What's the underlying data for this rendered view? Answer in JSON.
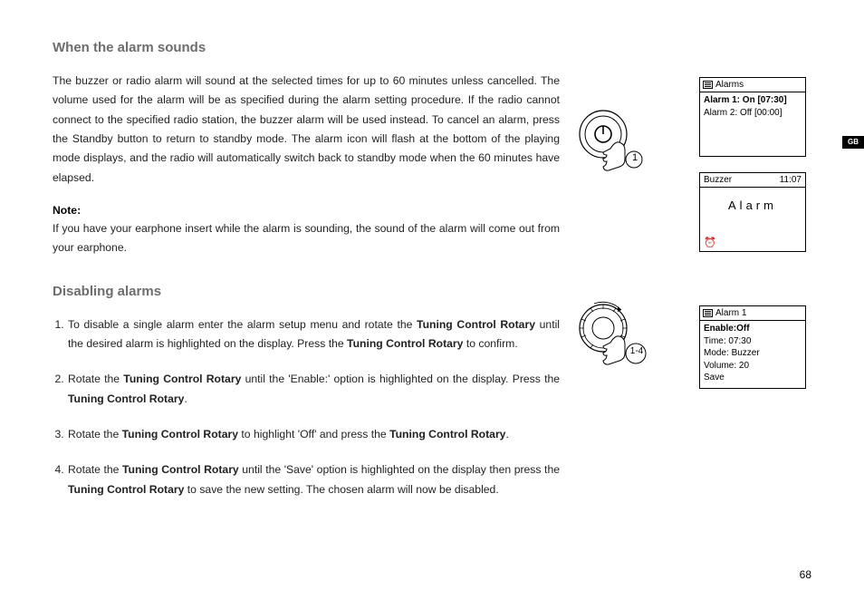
{
  "page_number": "68",
  "lang_tab": "GB",
  "sections": {
    "alarm_sounds": {
      "heading": "When the alarm sounds",
      "para": "The buzzer or radio alarm will sound at the selected times for up to 60 minutes unless cancelled. The volume used for the alarm will be as specified during the alarm setting procedure. If the radio cannot connect to the specified radio station, the buzzer alarm will be used instead. To cancel an alarm, press the Standby button to return to standby mode. The alarm icon will flash at the bottom of the playing mode displays, and the radio will automatically switch back to standby mode when the 60 minutes have elapsed.",
      "note_label": "Note:",
      "note_text": "If you have your earphone insert while the alarm is sounding, the sound of the alarm will come out from your earphone."
    },
    "disabling": {
      "heading": "Disabling alarms",
      "steps": {
        "s1a": "To disable a single alarm enter the alarm setup menu and rotate the ",
        "s1_tc1": "Tuning Control Rotary",
        "s1b": " until the desired alarm is highlighted on the display. Press the ",
        "s1_tc2": "Tuning Control Rotary",
        "s1c": " to confirm.",
        "s2a": "Rotate the ",
        "s2_tc1": "Tuning Control Rotary",
        "s2b": " until the 'Enable:' option is highlighted on the display. Press the ",
        "s2_tc2": "Tuning Control Rotary",
        "s2c": ".",
        "s3a": "Rotate the ",
        "s3_tc1": "Tuning Control Rotary",
        "s3b": " to highlight 'Off' and press the ",
        "s3_tc2": "Tuning Control Rotary",
        "s3c": ".",
        "s4a": "Rotate the ",
        "s4_tc1": "Tuning Control Rotary",
        "s4b": " until the 'Save' option is highlighted on the display then press the ",
        "s4_tc2": "Tuning Control Rotary",
        "s4c": " to save the new setting. The chosen alarm will now be disabled."
      }
    }
  },
  "illustrations": {
    "power_label": "1",
    "rotary_label": "1-4"
  },
  "panels": {
    "alarms_list": {
      "title": "Alarms",
      "row1": "Alarm 1: On [07:30]",
      "row2": "Alarm 2: Off [00:00]"
    },
    "buzzer": {
      "left": "Buzzer",
      "right": "11:07",
      "big": "Alarm"
    },
    "alarm1": {
      "title": "Alarm 1",
      "enable": "Enable:Off",
      "time": "Time: 07:30",
      "mode": "Mode: Buzzer",
      "volume": "Volume: 20",
      "save": "Save"
    }
  }
}
